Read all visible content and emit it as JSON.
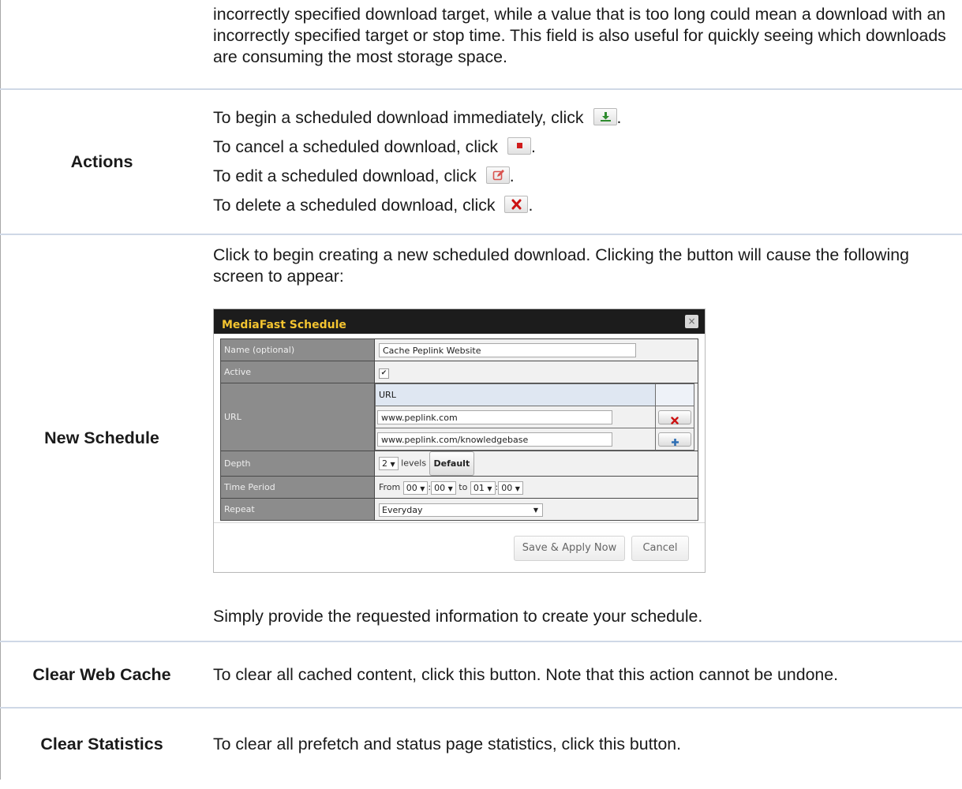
{
  "intro_text": "incorrectly specified download target, while a value that is too long could mean a download with an incorrectly specified target or stop time. This field is also useful for quickly seeing which downloads are consuming the most storage space.",
  "actions": {
    "label": "Actions",
    "lines": [
      {
        "text": "To begin a scheduled download immediately, click",
        "icon": "download-icon",
        "color": "#2e8b2e"
      },
      {
        "text": "To cancel a scheduled download, click",
        "icon": "stop-icon",
        "color": "#d01c1c"
      },
      {
        "text": "To edit a scheduled download, click",
        "icon": "edit-icon",
        "color": "#d9534f"
      },
      {
        "text": "To delete a scheduled download, click",
        "icon": "delete-icon",
        "color": "#cc1111"
      }
    ]
  },
  "new_schedule": {
    "label": "New Schedule",
    "description": "Click to begin creating a new scheduled download. Clicking the button will cause the following screen to appear:",
    "footer_text": "Simply provide the requested information to create your schedule.",
    "dialog": {
      "title": "MediaFast Schedule",
      "close_label": "×",
      "fields": {
        "name_label": "Name (optional)",
        "name_value": "Cache Peplink Website",
        "active_label": "Active",
        "active_checked": "✔",
        "url_label": "URL",
        "url_header": "URL",
        "urls": [
          "www.peplink.com",
          "www.peplink.com/knowledgebase"
        ],
        "depth_label": "Depth",
        "depth_value": "2",
        "levels_text": "levels",
        "default_button": "Default",
        "time_label": "Time Period",
        "from_text": "From",
        "from_hour": "00",
        "from_min": "00",
        "to_text": "to",
        "to_hour": "01",
        "to_min": "00",
        "repeat_label": "Repeat",
        "repeat_value": "Everyday"
      },
      "save_button": "Save & Apply Now",
      "cancel_button": "Cancel"
    }
  },
  "clear_web_cache": {
    "label": "Clear Web Cache",
    "description": "To clear all cached content, click this button. Note that this action cannot be undone."
  },
  "clear_statistics": {
    "label": "Clear Statistics",
    "description": "To clear all prefetch and status page statistics, click this button."
  }
}
